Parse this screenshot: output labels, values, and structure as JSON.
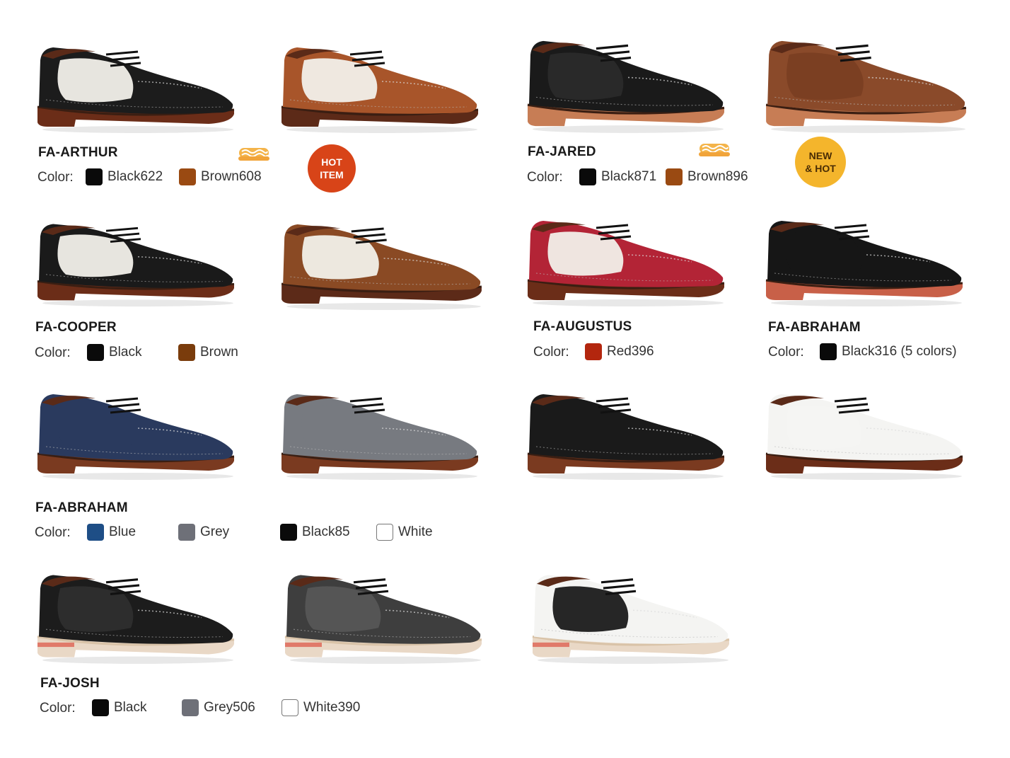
{
  "color_label": "Color:",
  "badges": {
    "hot_item": "HOT\nITEM",
    "new_hot": "NEW\n& HOT"
  },
  "products": [
    {
      "title": "FA-ARTHUR",
      "colors": [
        {
          "name": "Black622",
          "hex": "#0a0a0a"
        },
        {
          "name": "Brown608",
          "hex": "#9a4a12"
        }
      ]
    },
    {
      "title": "FA-JARED",
      "colors": [
        {
          "name": "Black871",
          "hex": "#0a0a0a"
        },
        {
          "name": "Brown896",
          "hex": "#9a4a12"
        }
      ]
    },
    {
      "title": "FA-COOPER",
      "colors": [
        {
          "name": "Black",
          "hex": "#0a0a0a"
        },
        {
          "name": "Brown",
          "hex": "#7a3c0c"
        }
      ]
    },
    {
      "title": "FA-AUGUSTUS",
      "colors": [
        {
          "name": "Red396",
          "hex": "#b3260e"
        }
      ]
    },
    {
      "title": "FA-ABRAHAM",
      "colors": [
        {
          "name": "Black316 (5 colors)",
          "hex": "#0a0a0a"
        }
      ]
    },
    {
      "title": "FA-ABRAHAM",
      "colors": [
        {
          "name": "Blue",
          "hex": "#1e4e86"
        },
        {
          "name": "Grey",
          "hex": "#6e7078"
        },
        {
          "name": "Black85",
          "hex": "#0a0a0a"
        },
        {
          "name": "White",
          "hex": "#ffffff"
        }
      ]
    },
    {
      "title": "FA-JOSH",
      "colors": [
        {
          "name": "Black",
          "hex": "#0a0a0a"
        },
        {
          "name": "Grey506",
          "hex": "#6e7078"
        },
        {
          "name": "White390",
          "hex": "#ffffff"
        }
      ]
    }
  ],
  "shoe_images": [
    {
      "name": "fa-arthur-black622-shoe",
      "upper": "#1c1c1c",
      "accent": "#f2f0ea",
      "sole": "#6b2d18"
    },
    {
      "name": "fa-arthur-brown608-shoe",
      "upper": "#a8552a",
      "accent": "#f2f0ea",
      "sole": "#5c2a18"
    },
    {
      "name": "fa-jared-black871-shoe",
      "upper": "#1a1a1a",
      "accent": "#2a2a2a",
      "sole": "#c77d55"
    },
    {
      "name": "fa-jared-brown896-shoe",
      "upper": "#8a4a2a",
      "accent": "#7a3e22",
      "sole": "#c77d55"
    },
    {
      "name": "fa-cooper-black-shoe",
      "upper": "#1a1a1a",
      "accent": "#f2f0ea",
      "sole": "#6b2d18"
    },
    {
      "name": "fa-cooper-brown-shoe",
      "upper": "#8a4a24",
      "accent": "#f2f0ea",
      "sole": "#5c2a18"
    },
    {
      "name": "fa-augustus-red396-shoe",
      "upper": "#b32436",
      "accent": "#f2f0ea",
      "sole": "#6b2d18"
    },
    {
      "name": "fa-abraham-black316-shoe",
      "upper": "#161616",
      "accent": "#161616",
      "sole": "#c86048"
    },
    {
      "name": "fa-abraham-blue-shoe",
      "upper": "#2a3a5e",
      "accent": "#2a3a5e",
      "sole": "#7a3a20"
    },
    {
      "name": "fa-abraham-grey-shoe",
      "upper": "#777a80",
      "accent": "#777a80",
      "sole": "#7a3a20"
    },
    {
      "name": "fa-abraham-black85-shoe",
      "upper": "#1a1a1a",
      "accent": "#1a1a1a",
      "sole": "#7a3a20"
    },
    {
      "name": "fa-abraham-white-shoe",
      "upper": "#f4f4f2",
      "accent": "#f4f4f2",
      "sole": "#6b2d18"
    },
    {
      "name": "fa-josh-black-shoe",
      "upper": "#1c1c1c",
      "accent": "#2e2e2e",
      "sole": "#e9d8c6"
    },
    {
      "name": "fa-josh-grey506-shoe",
      "upper": "#3e3e3e",
      "accent": "#565656",
      "sole": "#e9d8c6"
    },
    {
      "name": "fa-josh-white390-shoe",
      "upper": "#f4f4f2",
      "accent": "#1a1a1a",
      "sole": "#e9d8c6"
    }
  ]
}
